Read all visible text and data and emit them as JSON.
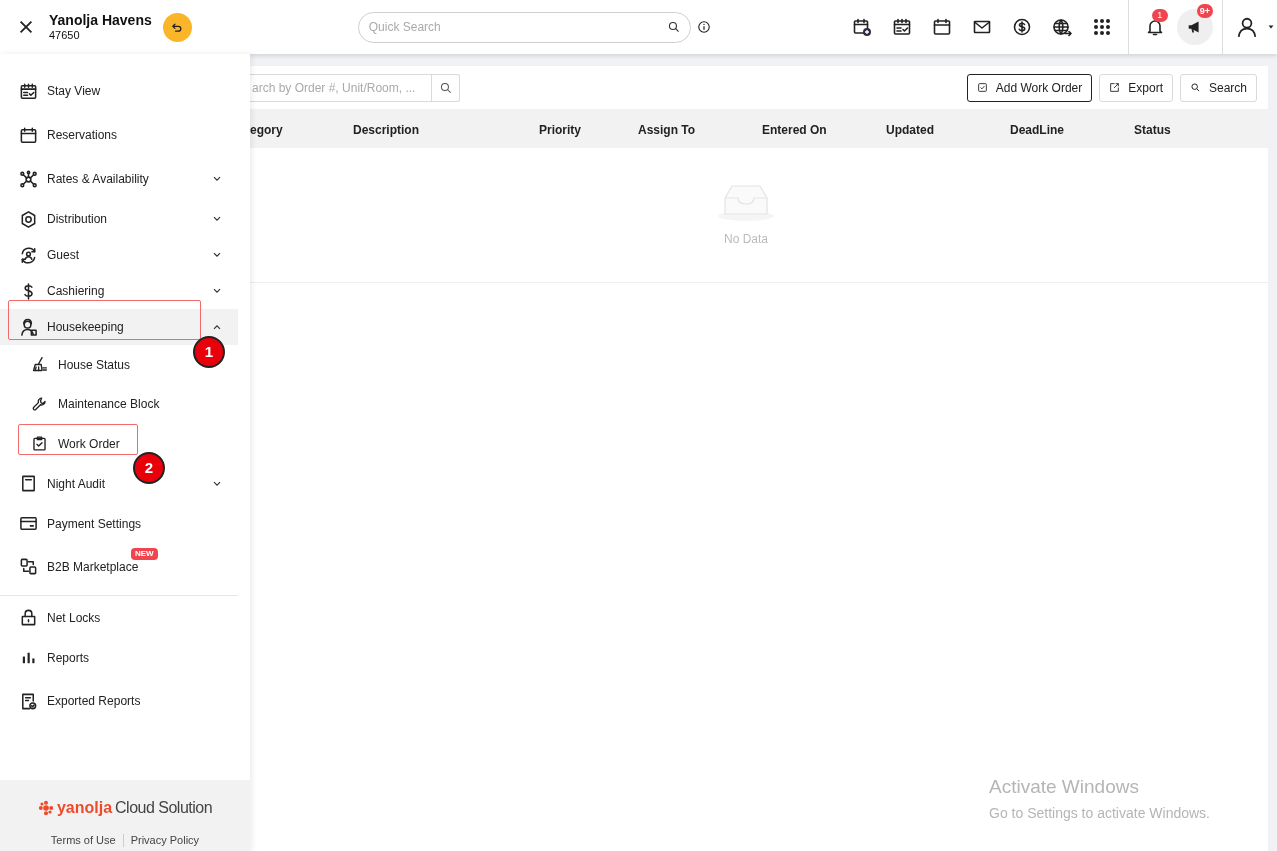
{
  "header": {
    "property_name": "Yanolja Havens",
    "property_code": "47650",
    "search": {
      "placeholder": "Quick Search"
    },
    "notification_count": "1",
    "announcement_count": "9+"
  },
  "sidebar": {
    "items": [
      {
        "label": "Stay View",
        "kind": "link",
        "selected": false
      },
      {
        "label": "Reservations",
        "kind": "link",
        "selected": false
      },
      {
        "label": "Rates & Availability",
        "kind": "group",
        "expanded": false,
        "selected": false
      },
      {
        "label": "Distribution",
        "kind": "group",
        "expanded": false,
        "selected": false
      },
      {
        "label": "Guest",
        "kind": "group",
        "expanded": false,
        "selected": false
      },
      {
        "label": "Cashiering",
        "kind": "group",
        "expanded": false,
        "selected": false
      },
      {
        "label": "Housekeeping",
        "kind": "group",
        "expanded": true,
        "selected": true,
        "children": [
          {
            "label": "House Status",
            "selected": false
          },
          {
            "label": "Maintenance Block",
            "selected": false
          },
          {
            "label": "Work Order",
            "selected": false
          }
        ]
      },
      {
        "label": "Night Audit",
        "kind": "group",
        "expanded": false,
        "selected": false
      },
      {
        "label": "Payment Settings",
        "kind": "link",
        "selected": false
      },
      {
        "label": "B2B Marketplace",
        "kind": "link",
        "selected": false,
        "badge": "NEW"
      }
    ],
    "items_after_divider": [
      {
        "label": "Net Locks",
        "selected": false
      },
      {
        "label": "Reports",
        "selected": false
      },
      {
        "label": "Exported Reports",
        "selected": false
      }
    ],
    "footer": {
      "logo_brand": "yanolja",
      "logo_suffix": "Cloud Solution",
      "links": [
        "Terms of Use",
        "Privacy Policy"
      ]
    }
  },
  "toolbar": {
    "search": {
      "placeholder": "arch by Order #, Unit/Room, ..."
    },
    "buttons": [
      "Add Work Order",
      "Export",
      "Search"
    ]
  },
  "table": {
    "columns": [
      "egory",
      "Description",
      "Priority",
      "Assign To",
      "Entered On",
      "Updated",
      "DeadLine",
      "Status"
    ],
    "empty_text": "No Data"
  },
  "annotations": [
    {
      "label": "1"
    },
    {
      "label": "2"
    }
  ],
  "os_overlay": {
    "title": "Activate Windows",
    "subtitle": "Go to Settings to activate Windows."
  }
}
